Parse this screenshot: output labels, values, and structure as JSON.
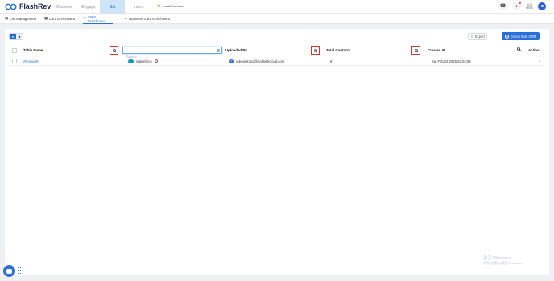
{
  "app": {
    "brand": "FlashRev"
  },
  "nav": {
    "items": [
      {
        "label": "Discover",
        "active": false
      },
      {
        "label": "Engage",
        "active": false
      },
      {
        "label": "Get",
        "active": true
      },
      {
        "label": "Intent",
        "active": false
      }
    ]
  },
  "install_extension": {
    "label": "Install Extension"
  },
  "header_right": {
    "phone_icon": "phone-icon",
    "bell_icon": "bell-icon",
    "credits_label": "0/24",
    "plan_label": "FREE",
    "avatar_initials": "HD"
  },
  "subtabs": [
    {
      "label": "List Management",
      "icon": "list-icon",
      "active": false
    },
    {
      "label": "CSV Enrichment",
      "icon": "csv-icon",
      "active": false
    },
    {
      "label": "CRM Enrichment",
      "icon": "crm-icon",
      "active": true
    },
    {
      "label": "Business Card Enrichment",
      "icon": "card-icon",
      "active": false
    }
  ],
  "toolbar": {
    "export_label": "Export",
    "enrich_label": "Enrich from CRM"
  },
  "search": {
    "placeholder": "Search",
    "value": ""
  },
  "table": {
    "columns": [
      "Table Name",
      "Uploaded By",
      "Total Contacts",
      "Created At",
      "Action"
    ],
    "rows": [
      {
        "table_name": "zhenxu001",
        "source": "Salesforce",
        "uploaded_by": "yukongkong@myflashcloud.com",
        "total_contacts": "6",
        "created_at": "Sat Feb 22 2025 02:03:09",
        "action": "⋮"
      }
    ]
  },
  "watermark": {
    "line1": "激活 Windows",
    "line2": "转到\"设置\"以激活 Windows。"
  },
  "colors": {
    "accent": "#2a6fd6",
    "highlight_border": "#d9342b",
    "nav_active_bg": "#cfe4f7"
  }
}
